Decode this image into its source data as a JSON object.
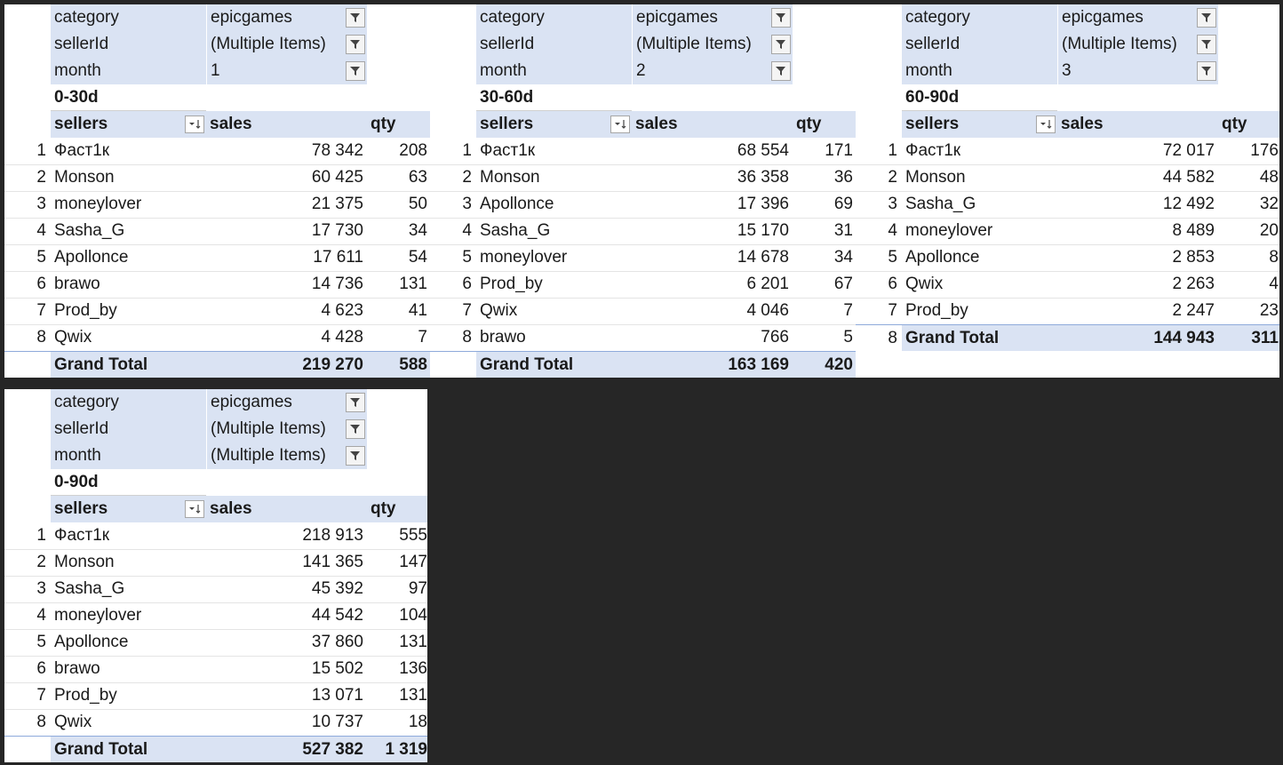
{
  "pivots": [
    {
      "filters": [
        {
          "field": "category",
          "value": "epicgames"
        },
        {
          "field": "sellerId",
          "value": "(Multiple Items)"
        },
        {
          "field": "month",
          "value": "1"
        }
      ],
      "bucket": "0-30d",
      "headers": {
        "sellers": "sellers",
        "sales": "sales",
        "qty": "qty"
      },
      "rows": [
        {
          "idx": "1",
          "seller": "Фаст1к",
          "sales": "78 342",
          "qty": "208"
        },
        {
          "idx": "2",
          "seller": "Monson",
          "sales": "60 425",
          "qty": "63"
        },
        {
          "idx": "3",
          "seller": "moneylover",
          "sales": "21 375",
          "qty": "50"
        },
        {
          "idx": "4",
          "seller": "Sasha_G",
          "sales": "17 730",
          "qty": "34"
        },
        {
          "idx": "5",
          "seller": "Apollonce",
          "sales": "17 611",
          "qty": "54"
        },
        {
          "idx": "6",
          "seller": "brawo",
          "sales": "14 736",
          "qty": "131"
        },
        {
          "idx": "7",
          "seller": "Prod_by",
          "sales": "4 623",
          "qty": "41"
        },
        {
          "idx": "8",
          "seller": "Qwix",
          "sales": "4 428",
          "qty": "7"
        }
      ],
      "total": {
        "label": "Grand Total",
        "sales": "219 270",
        "qty": "588"
      }
    },
    {
      "filters": [
        {
          "field": "category",
          "value": "epicgames"
        },
        {
          "field": "sellerId",
          "value": "(Multiple Items)"
        },
        {
          "field": "month",
          "value": "2"
        }
      ],
      "bucket": "30-60d",
      "headers": {
        "sellers": "sellers",
        "sales": "sales",
        "qty": "qty"
      },
      "rows": [
        {
          "idx": "1",
          "seller": "Фаст1к",
          "sales": "68 554",
          "qty": "171"
        },
        {
          "idx": "2",
          "seller": "Monson",
          "sales": "36 358",
          "qty": "36"
        },
        {
          "idx": "3",
          "seller": "Apollonce",
          "sales": "17 396",
          "qty": "69"
        },
        {
          "idx": "4",
          "seller": "Sasha_G",
          "sales": "15 170",
          "qty": "31"
        },
        {
          "idx": "5",
          "seller": "moneylover",
          "sales": "14 678",
          "qty": "34"
        },
        {
          "idx": "6",
          "seller": "Prod_by",
          "sales": "6 201",
          "qty": "67"
        },
        {
          "idx": "7",
          "seller": "Qwix",
          "sales": "4 046",
          "qty": "7"
        },
        {
          "idx": "8",
          "seller": "brawo",
          "sales": "766",
          "qty": "5"
        }
      ],
      "total": {
        "label": "Grand Total",
        "sales": "163 169",
        "qty": "420"
      }
    },
    {
      "filters": [
        {
          "field": "category",
          "value": "epicgames"
        },
        {
          "field": "sellerId",
          "value": "(Multiple Items)"
        },
        {
          "field": "month",
          "value": "3"
        }
      ],
      "bucket": "60-90d",
      "headers": {
        "sellers": "sellers",
        "sales": "sales",
        "qty": "qty"
      },
      "rows": [
        {
          "idx": "1",
          "seller": "Фаст1к",
          "sales": "72 017",
          "qty": "176"
        },
        {
          "idx": "2",
          "seller": "Monson",
          "sales": "44 582",
          "qty": "48"
        },
        {
          "idx": "3",
          "seller": "Sasha_G",
          "sales": "12 492",
          "qty": "32"
        },
        {
          "idx": "4",
          "seller": "moneylover",
          "sales": "8 489",
          "qty": "20"
        },
        {
          "idx": "5",
          "seller": "Apollonce",
          "sales": "2 853",
          "qty": "8"
        },
        {
          "idx": "6",
          "seller": "Qwix",
          "sales": "2 263",
          "qty": "4"
        },
        {
          "idx": "7",
          "seller": "Prod_by",
          "sales": "2 247",
          "qty": "23"
        }
      ],
      "total": {
        "idx": "8",
        "label": "Grand Total",
        "sales": "144 943",
        "qty": "311"
      }
    },
    {
      "filters": [
        {
          "field": "category",
          "value": "epicgames"
        },
        {
          "field": "sellerId",
          "value": "(Multiple Items)"
        },
        {
          "field": "month",
          "value": "(Multiple Items)"
        }
      ],
      "bucket": "0-90d",
      "headers": {
        "sellers": "sellers",
        "sales": "sales",
        "qty": "qty"
      },
      "rows": [
        {
          "idx": "1",
          "seller": "Фаст1к",
          "sales": "218 913",
          "qty": "555"
        },
        {
          "idx": "2",
          "seller": "Monson",
          "sales": "141 365",
          "qty": "147"
        },
        {
          "idx": "3",
          "seller": "Sasha_G",
          "sales": "45 392",
          "qty": "97"
        },
        {
          "idx": "4",
          "seller": "moneylover",
          "sales": "44 542",
          "qty": "104"
        },
        {
          "idx": "5",
          "seller": "Apollonce",
          "sales": "37 860",
          "qty": "131"
        },
        {
          "idx": "6",
          "seller": "brawo",
          "sales": "15 502",
          "qty": "136"
        },
        {
          "idx": "7",
          "seller": "Prod_by",
          "sales": "13 071",
          "qty": "131"
        },
        {
          "idx": "8",
          "seller": "Qwix",
          "sales": "10 737",
          "qty": "18"
        }
      ],
      "total": {
        "label": "Grand Total",
        "sales": "527 382",
        "qty": "1 319"
      }
    }
  ]
}
